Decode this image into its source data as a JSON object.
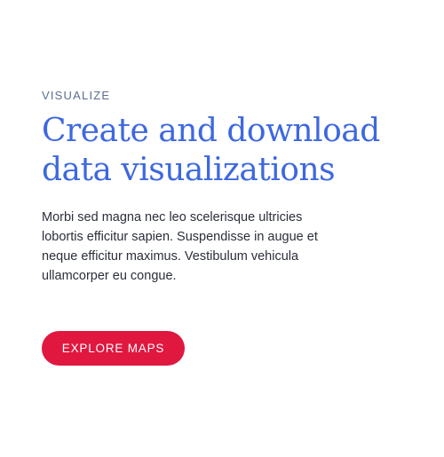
{
  "hero": {
    "eyebrow": "VISUALIZE",
    "headline": "Create and download data visualizations",
    "body": "Morbi sed magna nec leo scelerisque ultricies lobortis efficitur sapien. Suspendisse in augue et neque efficitur maximus. Vestibulum vehicula ullamcorper eu congue.",
    "cta_label": "EXPLORE MAPS"
  },
  "colors": {
    "eyebrow": "#5b6d8f",
    "headline": "#3d68e0",
    "body": "#2b2f3a",
    "cta_background": "#e0173f",
    "cta_text": "#ffffff"
  }
}
